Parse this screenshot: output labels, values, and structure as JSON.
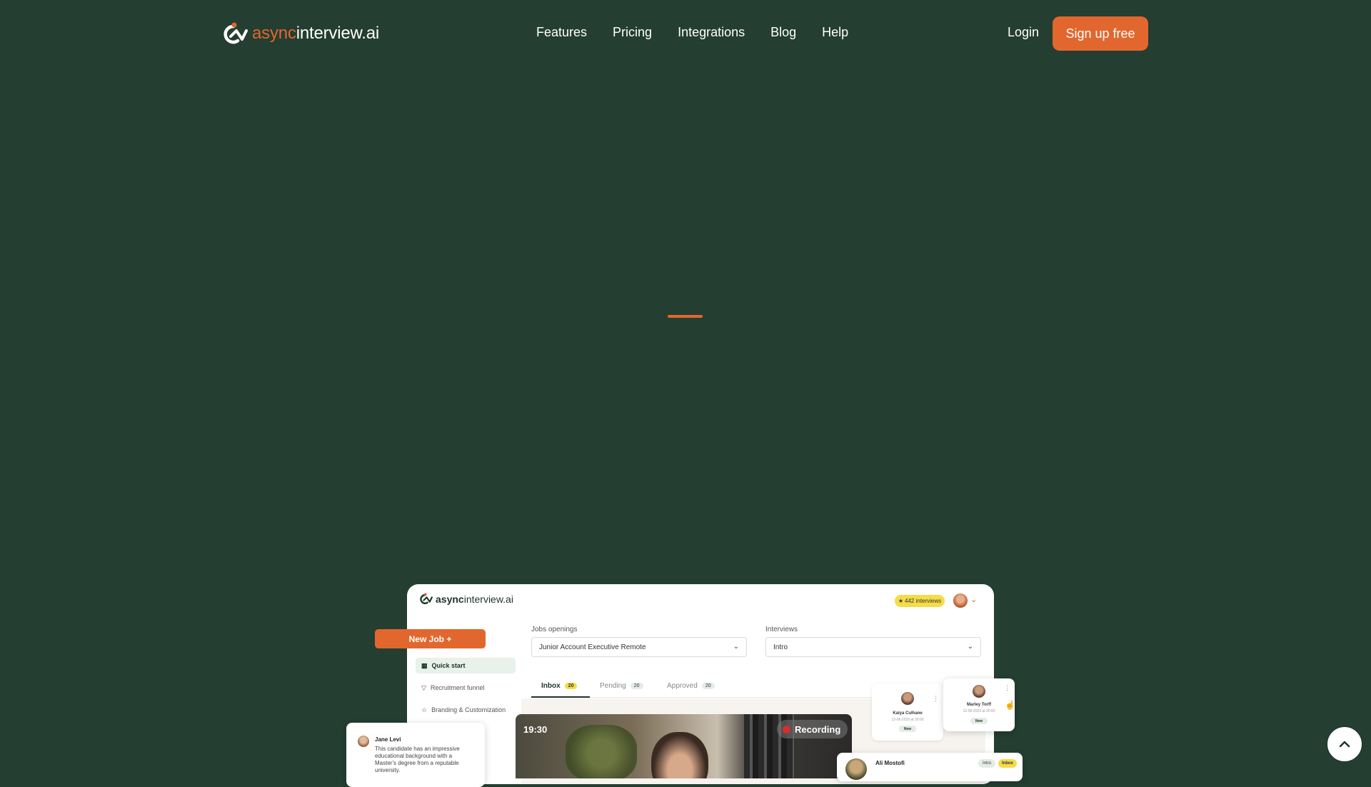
{
  "brand": {
    "name_accent": "async",
    "name_rest": "interview.ai"
  },
  "nav": {
    "items": [
      {
        "label": "Features"
      },
      {
        "label": "Pricing"
      },
      {
        "label": "Integrations"
      },
      {
        "label": "Blog"
      },
      {
        "label": "Help"
      }
    ],
    "login_label": "Login",
    "signup_label": "Sign up free"
  },
  "colors": {
    "background": "#243e31",
    "accent": "#e2672e",
    "badge": "#f5dc48",
    "dark": "#1d3328"
  },
  "dashboard": {
    "brand_bold": "async",
    "brand_rest": "interview.ai",
    "interviews_badge": "442 interviews",
    "new_job_label": "New Job",
    "jobs_label": "Jobs openings",
    "jobs_value": "Junior Account Executive Remote",
    "interviews_label": "Interviews",
    "interviews_value": "Intro",
    "sidebar": [
      {
        "label": "Quick start"
      },
      {
        "label": "Recruitment funnel"
      },
      {
        "label": "Branding & Customization"
      }
    ],
    "tabs": [
      {
        "label": "Inbox",
        "count": "20"
      },
      {
        "label": "Pending",
        "count": "20"
      },
      {
        "label": "Approved",
        "count": "20"
      }
    ],
    "video": {
      "time": "19:30",
      "status": "Recording"
    },
    "comment": {
      "name": "Jane Levi",
      "text": "This candidate has an impressive educational background with a Master's degree from a reputable university."
    },
    "candidates": [
      {
        "name": "Kaiya Culhane",
        "date": "12-06-2023 at 20:00",
        "status": "New"
      },
      {
        "name": "Marley Torff",
        "date": "12-06-2023 at 20:00",
        "status": "New"
      }
    ],
    "ali": {
      "name": "Ali Mostofi",
      "tag1": "Intro",
      "tag2": "Inbox"
    }
  }
}
